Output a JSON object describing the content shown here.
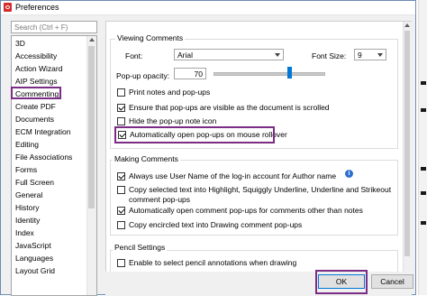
{
  "window": {
    "title": "Preferences"
  },
  "sidebar": {
    "search_placeholder": "Search (Ctrl + F)",
    "items": [
      {
        "label": "3D"
      },
      {
        "label": "Accessibility"
      },
      {
        "label": "Action Wizard"
      },
      {
        "label": "AIP Settings"
      },
      {
        "label": "Commenting",
        "selected": true
      },
      {
        "label": "Create PDF"
      },
      {
        "label": "Documents"
      },
      {
        "label": "ECM Integration"
      },
      {
        "label": "Editing"
      },
      {
        "label": "File Associations"
      },
      {
        "label": "Forms"
      },
      {
        "label": "Full Screen"
      },
      {
        "label": "General"
      },
      {
        "label": "History"
      },
      {
        "label": "Identity"
      },
      {
        "label": "Index"
      },
      {
        "label": "JavaScript"
      },
      {
        "label": "Languages"
      },
      {
        "label": "Layout Grid"
      }
    ]
  },
  "viewing": {
    "group_label": "Viewing Comments",
    "font_label": "Font:",
    "font_value": "Arial",
    "font_size_label": "Font Size:",
    "font_size_value": "9",
    "opacity_label": "Pop-up opacity:",
    "opacity_value": "70",
    "opacity_fraction": 0.7,
    "checkboxes": [
      {
        "label": "Print notes and pop-ups",
        "checked": false
      },
      {
        "label": "Ensure that pop-ups are visible as the document is scrolled",
        "checked": true
      },
      {
        "label": "Hide the pop-up note icon",
        "checked": false
      },
      {
        "label": "Automatically open pop-ups on mouse rollover",
        "checked": true
      }
    ]
  },
  "making": {
    "group_label": "Making Comments",
    "checkboxes": [
      {
        "label": "Always use User Name of the log-in account for Author name",
        "checked": true
      },
      {
        "label": "Copy selected text into Highlight, Squiggly Underline, Underline and Strikeout comment pop-ups",
        "checked": false
      },
      {
        "label": "Automatically open comment pop-ups for comments other than notes",
        "checked": true
      },
      {
        "label": "Copy encircled text into Drawing comment pop-ups",
        "checked": false
      }
    ]
  },
  "pencil": {
    "group_label": "Pencil Settings",
    "checkboxes": [
      {
        "label": "Enable to select pencil annotations when drawing",
        "checked": false
      }
    ]
  },
  "buttons": {
    "ok": "OK",
    "cancel": "Cancel"
  },
  "colors": {
    "highlight": "#7b2c85",
    "accent": "#0078d7"
  }
}
